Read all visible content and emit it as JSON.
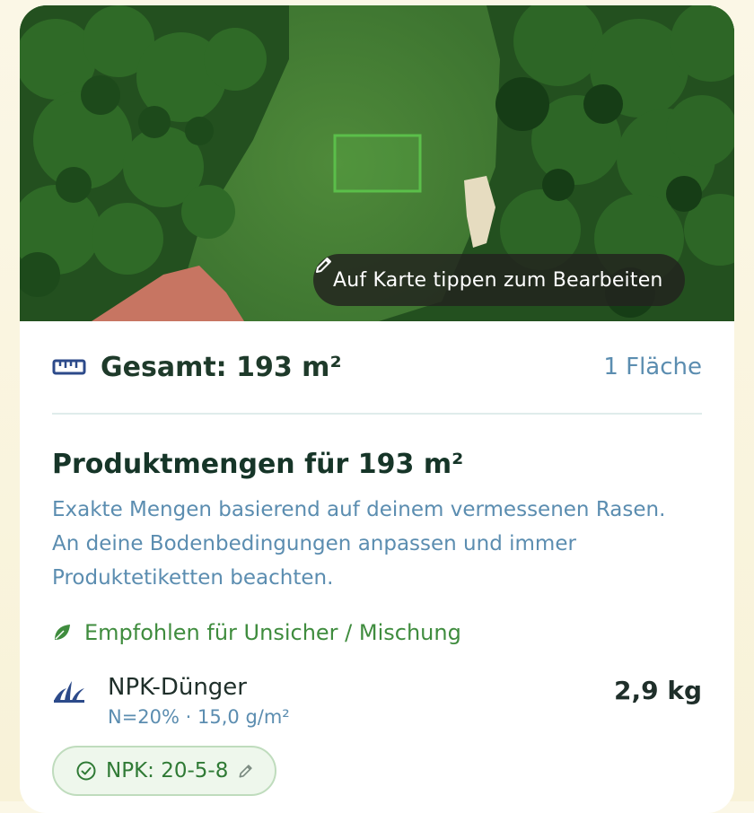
{
  "map": {
    "hint_label": "Auf Karte tippen zum Bearbeiten",
    "hint_icon": "pencil-icon"
  },
  "summary": {
    "total_label": "Gesamt: 193 m²",
    "area_count": "1 Fläche",
    "icon": "ruler-icon"
  },
  "products": {
    "title": "Produktmengen für 193 m²",
    "description_lines": [
      "Exakte Mengen basierend auf deinem vermessenen Rasen.",
      "An deine Bodenbedingungen anpassen und immer",
      "Produktetiketten beachten."
    ],
    "recommendation": "Empfohlen für Unsicher / Mischung",
    "items": [
      {
        "name": "NPK-Dünger",
        "detail": "N=20% · 15,0 g/m²",
        "amount": "2,9 kg",
        "icon": "grass-icon",
        "npk_label": "NPK: 20-5-8"
      }
    ]
  },
  "colors": {
    "accent_green": "#3f8c3e",
    "link_blue": "#5b8db0",
    "heading": "#163528"
  }
}
